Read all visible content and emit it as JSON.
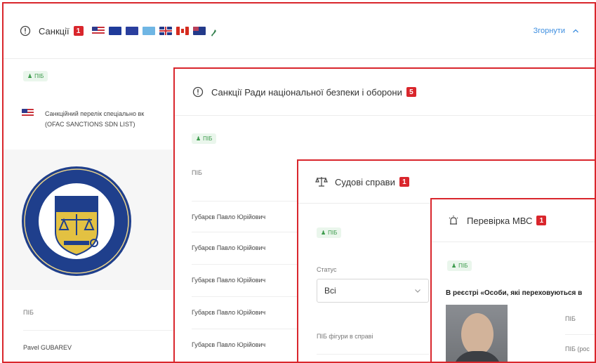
{
  "panel1": {
    "title": "Санкції",
    "badge": "1",
    "collapse_label": "Згорнути",
    "chip_label": "ПІБ",
    "list_title_line1": "Санкційний перелік спеціально вк",
    "list_title_line2": "(OFAC SANCTIONS SDN LIST)",
    "field_label": "ПІБ",
    "field_value": "Pavel GUBAREV"
  },
  "panel2": {
    "title": "Санкції Ради національної безпеки і оборони",
    "badge": "5",
    "chip_label": "ПІБ",
    "column_label": "ПІБ",
    "rows": [
      "Губарєв Павло Юрійович",
      "Губарєв Павло Юрійович",
      "Губарєв Павло Юрійович",
      "Губарєв Павло Юрійович",
      "Губарєв Павло Юрійович"
    ]
  },
  "panel3": {
    "title": "Судові справи",
    "badge": "1",
    "chip_label": "ПІБ",
    "status_label": "Статус",
    "status_value": "Всі",
    "search_label": "ПІБ фігури в справі"
  },
  "panel4": {
    "title": "Перевірка МВС",
    "badge": "1",
    "chip_label": "ПІБ",
    "registry_text": "В реєстрі «Особи, які переховуються в",
    "field1": "ПІБ",
    "field2": "ПІБ (рос"
  },
  "colors": {
    "accent_red": "#d9262c",
    "link_blue": "#3d8ee0",
    "chip_green": "#3a9a4a"
  }
}
